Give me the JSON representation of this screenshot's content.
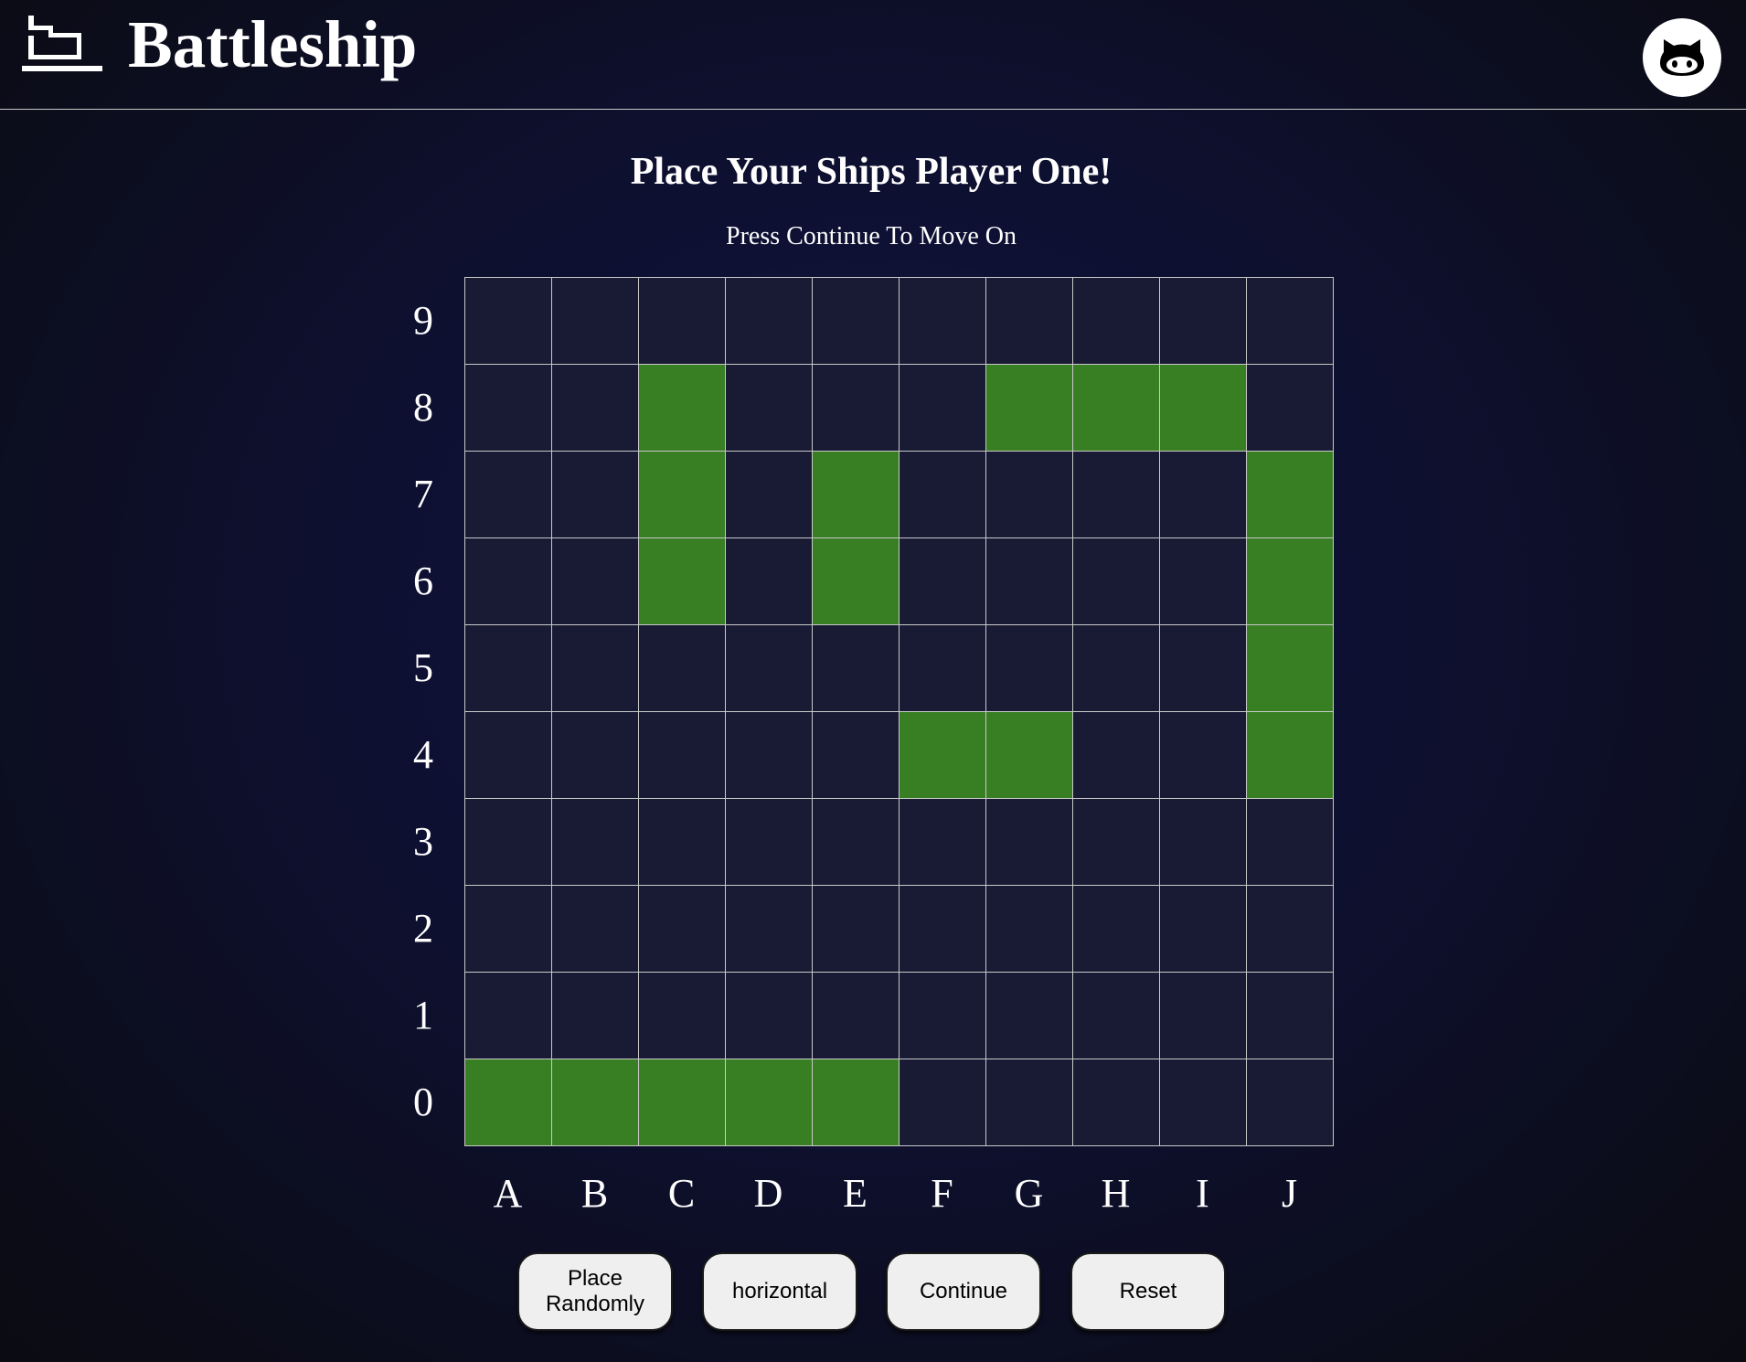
{
  "header": {
    "title": "Battleship",
    "logo_icon": "ship-icon",
    "github_icon": "github-icon"
  },
  "main": {
    "heading": "Place Your Ships Player One!",
    "subheading": "Press Continue To Move On"
  },
  "board": {
    "row_labels": [
      "9",
      "8",
      "7",
      "6",
      "5",
      "4",
      "3",
      "2",
      "1",
      "0"
    ],
    "col_labels": [
      "A",
      "B",
      "C",
      "D",
      "E",
      "F",
      "G",
      "H",
      "I",
      "J"
    ],
    "ship_cells": [
      "C8",
      "G8",
      "H8",
      "I8",
      "C7",
      "E7",
      "J7",
      "C6",
      "E6",
      "J6",
      "J5",
      "F4",
      "G4",
      "J4",
      "A0",
      "B0",
      "C0",
      "D0",
      "E0"
    ],
    "empty_color": "#191a34",
    "ship_color": "#387e23"
  },
  "controls": {
    "place_randomly": "Place Randomly",
    "orientation": "horizontal",
    "continue": "Continue",
    "reset": "Reset"
  }
}
